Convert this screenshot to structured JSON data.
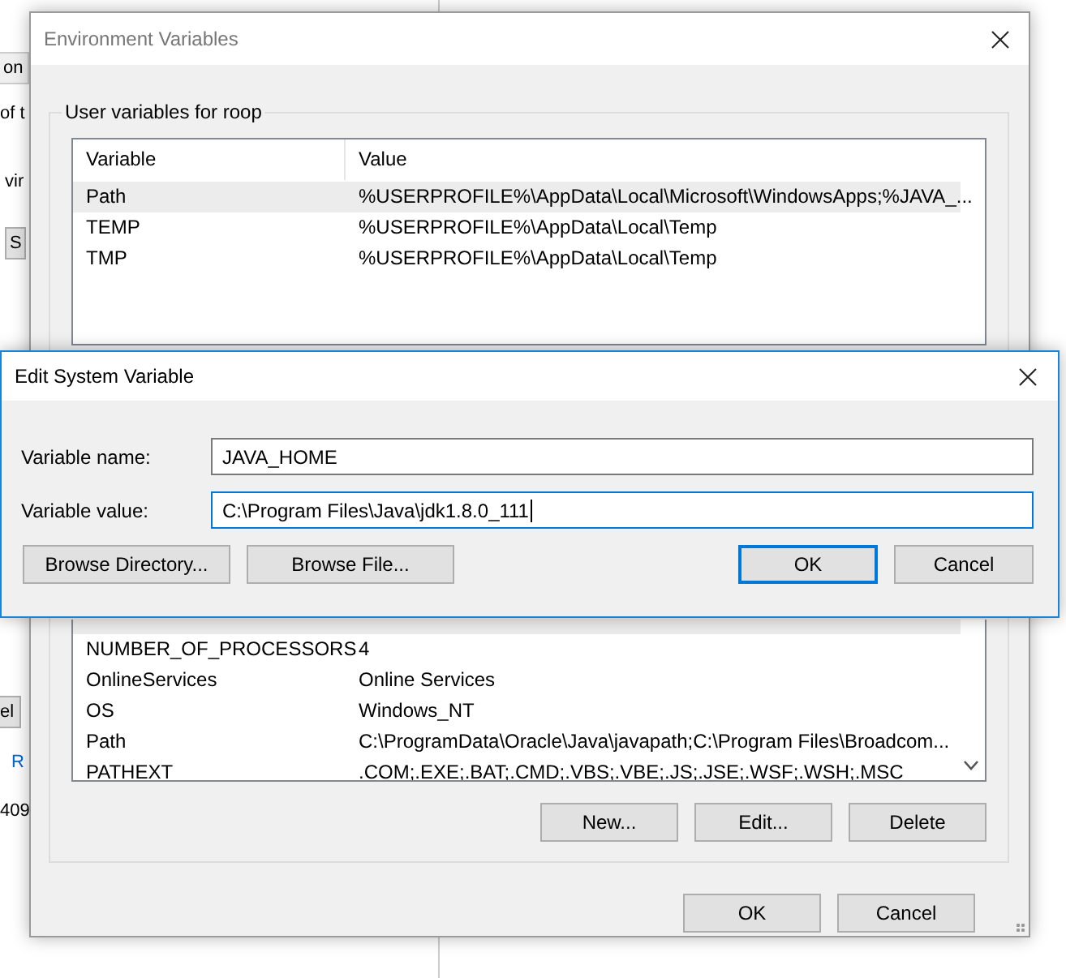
{
  "background_window": {
    "fragments": [
      {
        "text": "on",
        "kind": "tab"
      },
      {
        "text": "of t",
        "kind": "text"
      },
      {
        "text": "vir",
        "kind": "text"
      },
      {
        "text": "S",
        "kind": "button"
      },
      {
        "text": "el",
        "kind": "button"
      },
      {
        "text": "R",
        "kind": "link"
      },
      {
        "text": "409",
        "kind": "text"
      }
    ]
  },
  "environment_window": {
    "title": "Environment Variables",
    "user_variables": {
      "label": "User variables for roop",
      "columns": [
        "Variable",
        "Value"
      ],
      "rows": [
        {
          "variable": "Path",
          "value": "%USERPROFILE%\\AppData\\Local\\Microsoft\\WindowsApps;%JAVA_...",
          "selected": true
        },
        {
          "variable": "TEMP",
          "value": "%USERPROFILE%\\AppData\\Local\\Temp",
          "selected": false
        },
        {
          "variable": "TMP",
          "value": "%USERPROFILE%\\AppData\\Local\\Temp",
          "selected": false
        }
      ]
    },
    "system_variables": {
      "rows": [
        {
          "variable": "NUMBER_OF_PROCESSORS",
          "value": "4",
          "selected": false
        },
        {
          "variable": "OnlineServices",
          "value": "Online Services",
          "selected": false
        },
        {
          "variable": "OS",
          "value": "Windows_NT",
          "selected": false
        },
        {
          "variable": "Path",
          "value": "C:\\ProgramData\\Oracle\\Java\\javapath;C:\\Program Files\\Broadcom...",
          "selected": false
        },
        {
          "variable": "PATHEXT",
          "value": ".COM;.EXE;.BAT;.CMD;.VBS;.VBE;.JS;.JSE;.WSF;.WSH;.MSC",
          "selected": false
        }
      ],
      "buttons": [
        "New...",
        "Edit...",
        "Delete"
      ]
    },
    "buttons": [
      "OK",
      "Cancel"
    ]
  },
  "edit_dialog": {
    "title": "Edit System Variable",
    "fields": [
      {
        "label": "Variable name:",
        "value": "JAVA_HOME",
        "focused": false
      },
      {
        "label": "Variable value:",
        "value": "C:\\Program Files\\Java\\jdk1.8.0_111",
        "focused": true
      }
    ],
    "left_buttons": [
      {
        "label": "Browse Directory...",
        "default": false
      },
      {
        "label": "Browse File...",
        "default": false
      }
    ],
    "right_buttons": [
      {
        "label": "OK",
        "default": true
      },
      {
        "label": "Cancel",
        "default": false
      }
    ]
  }
}
